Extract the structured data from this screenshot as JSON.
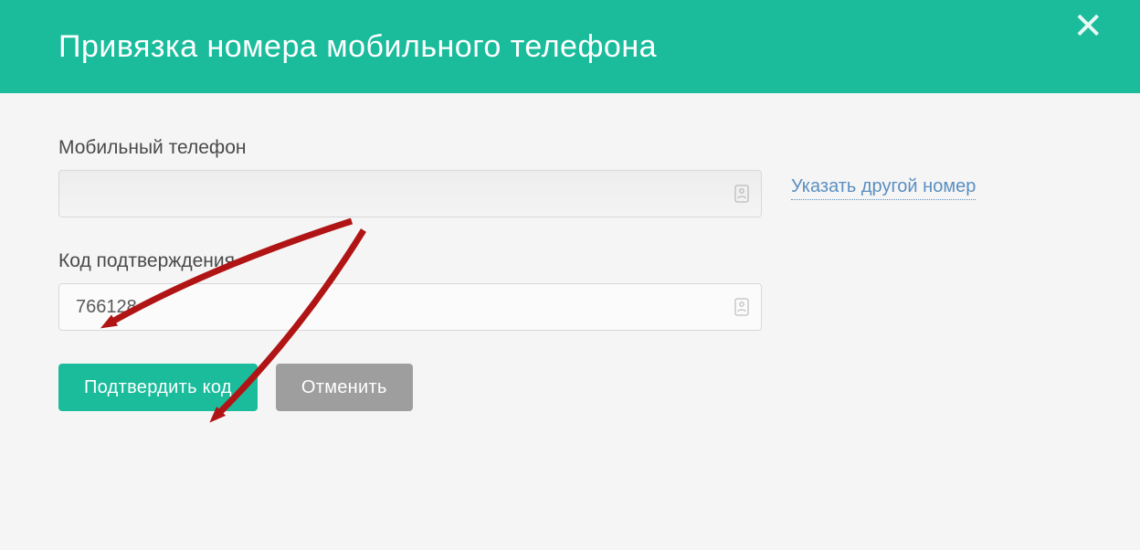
{
  "header": {
    "title": "Привязка номера мобильного телефона"
  },
  "form": {
    "phone_label": "Мобильный телефон",
    "phone_value": "",
    "change_number_link": "Указать другой номер",
    "code_label": "Код подтверждения",
    "code_value": "766128"
  },
  "buttons": {
    "confirm": "Подтвердить код",
    "cancel": "Отменить"
  },
  "colors": {
    "accent": "#1abc9c",
    "arrow": "#b01414"
  }
}
